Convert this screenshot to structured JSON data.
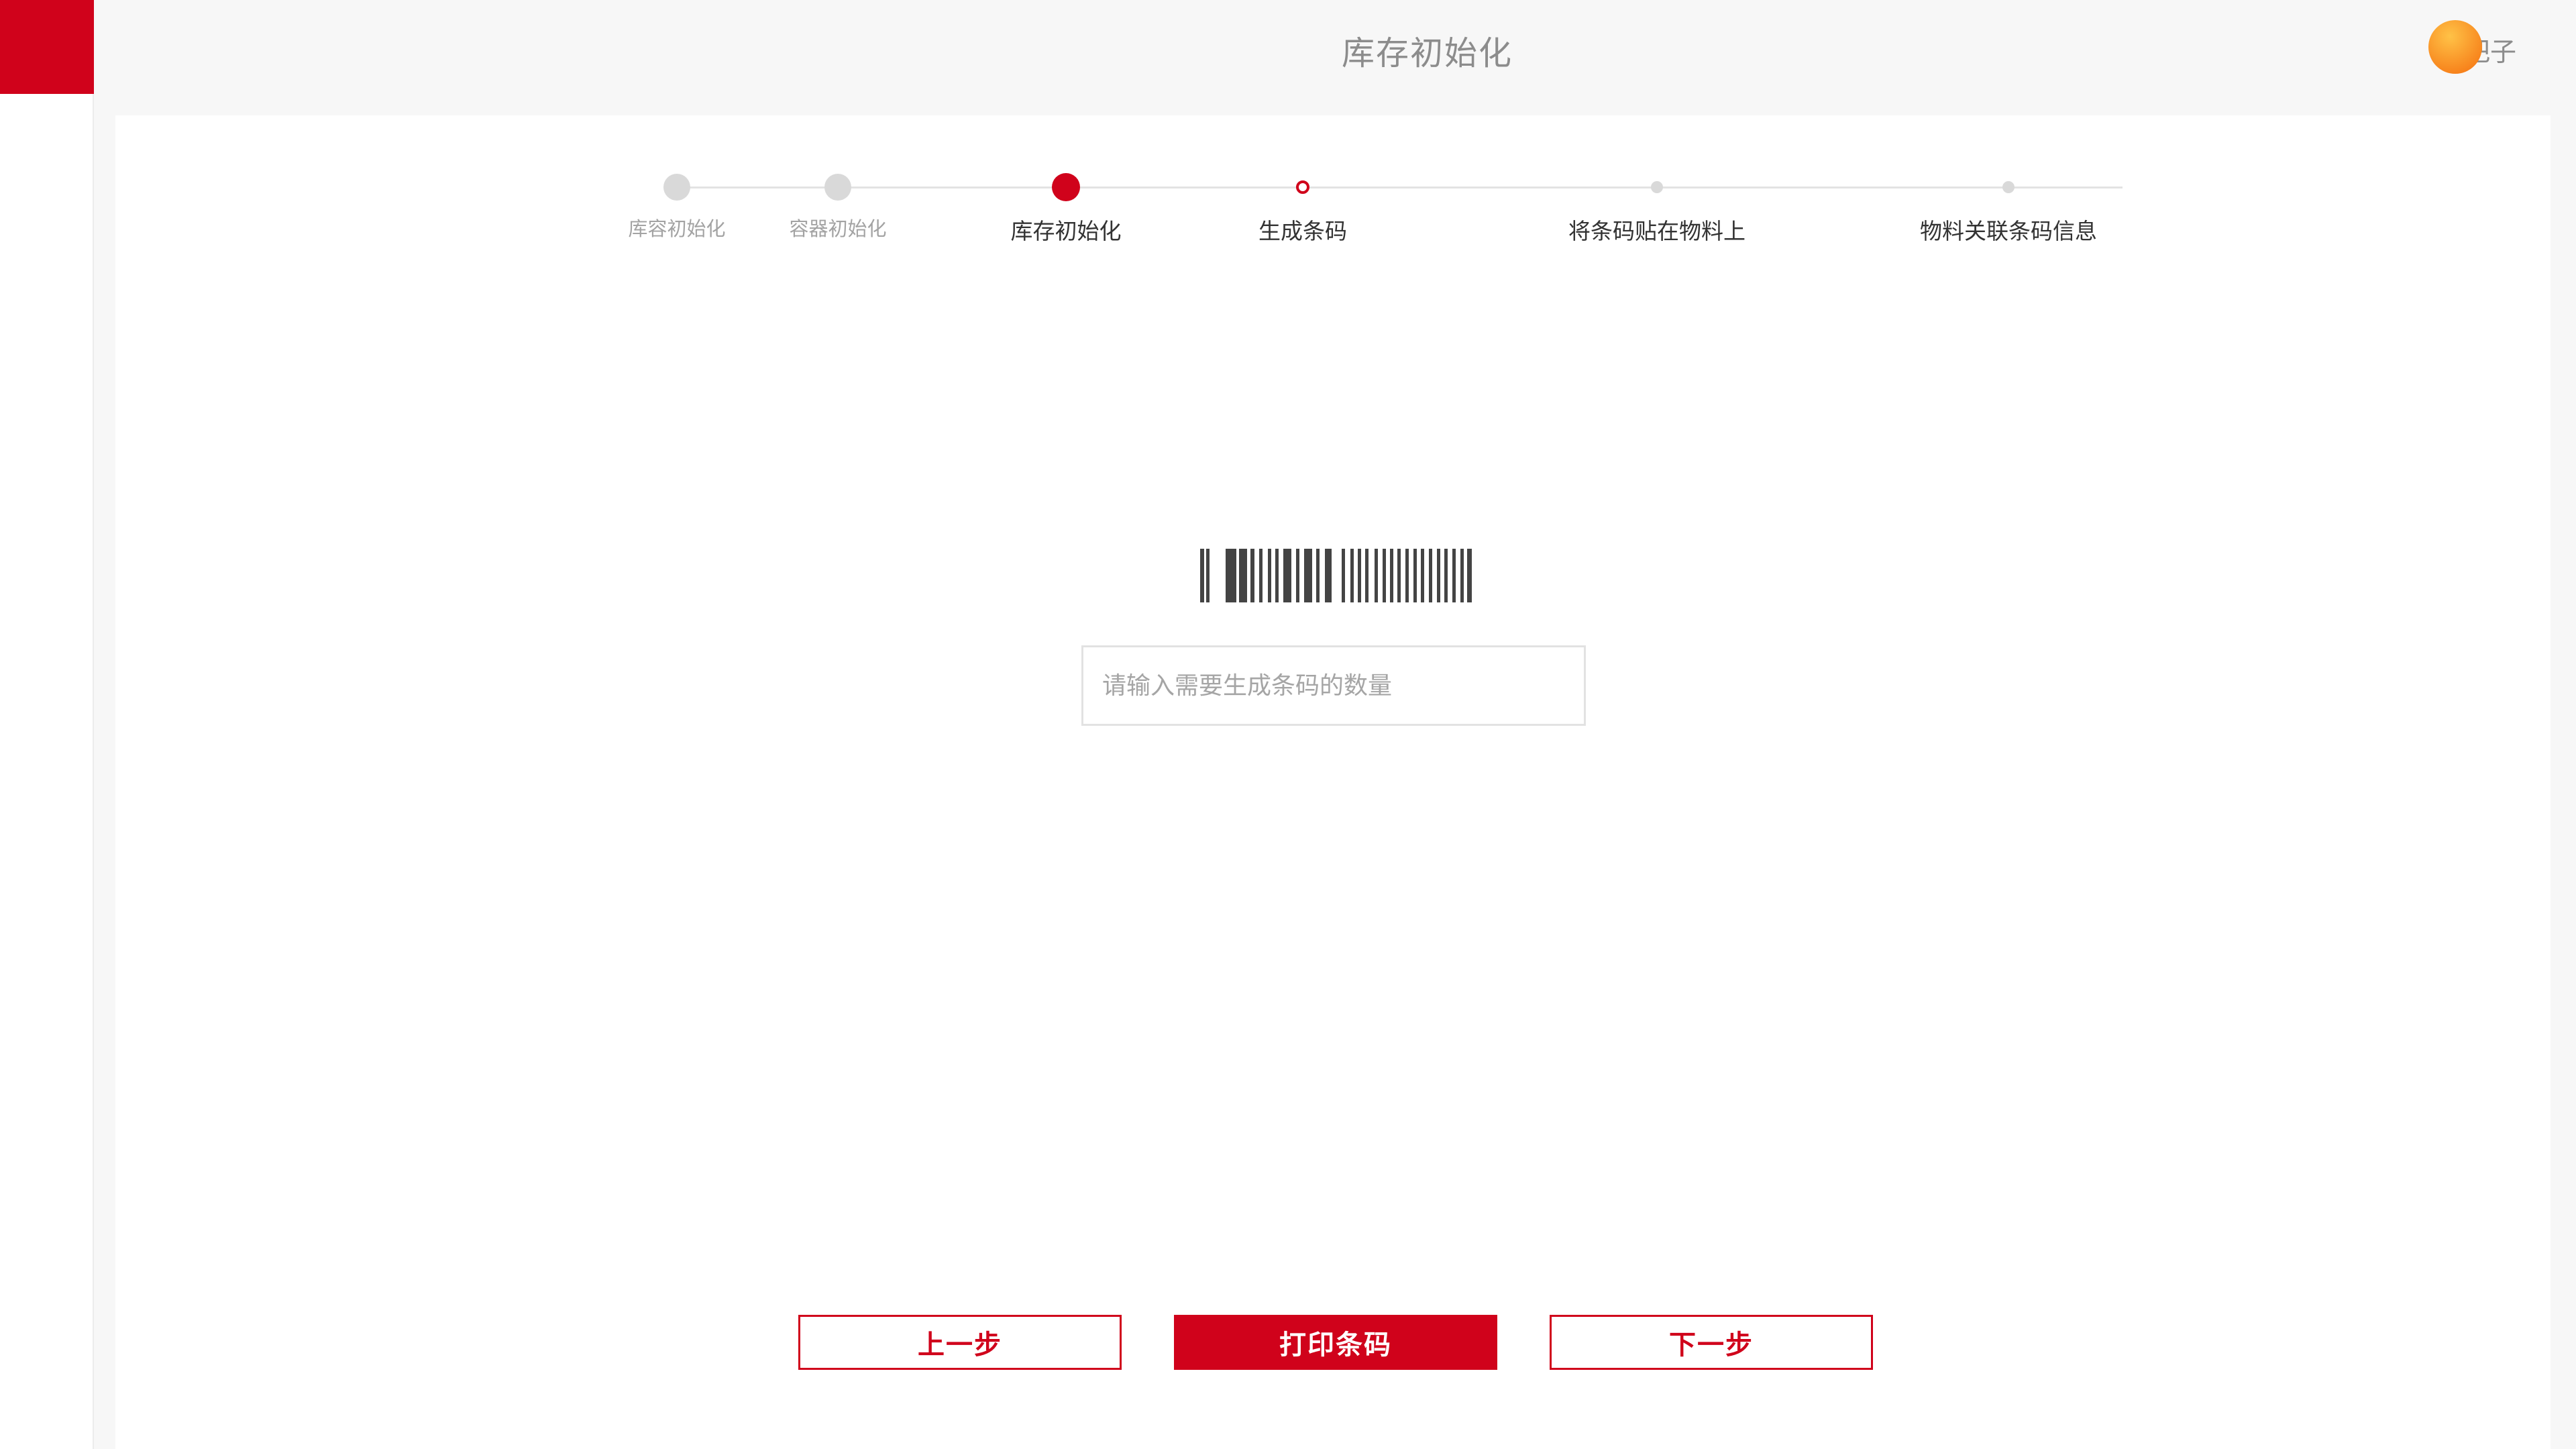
{
  "header": {
    "title": "库存初始化",
    "user_name": "扛把子"
  },
  "colors": {
    "accent": "#d0021b",
    "inactive": "#d9d9d9"
  },
  "steps": [
    {
      "label": "库容初始化",
      "state": "done"
    },
    {
      "label": "容器初始化",
      "state": "done"
    },
    {
      "label": "库存初始化",
      "state": "active"
    },
    {
      "label": "生成条码",
      "state": "current"
    },
    {
      "label": "将条码贴在物料上",
      "state": "pending"
    },
    {
      "label": "物料关联条码信息",
      "state": "pending"
    }
  ],
  "barcode": {
    "icon": "barcode-icon"
  },
  "quantity_input": {
    "value": "",
    "placeholder": "请输入需要生成条码的数量"
  },
  "buttons": {
    "prev": "上一步",
    "print": "打印条码",
    "next": "下一步"
  }
}
